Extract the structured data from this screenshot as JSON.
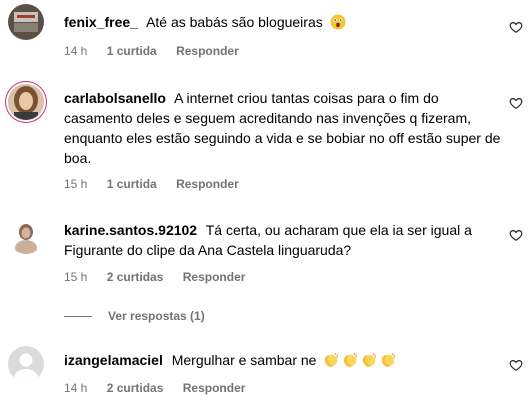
{
  "comments": [
    {
      "username": "fenix_free_",
      "text": "Até as babás são blogueiras",
      "emoji": "astonished-face",
      "time": "14 h",
      "likes": "1 curtida",
      "reply": "Responder"
    },
    {
      "username": "carlabolsanello",
      "text": "A internet criou tantas coisas para o fim do casamento deles e seguem acreditando nas invenções q fizeram, enquanto eles estão seguindo a vida e se bobiar no off estão super de boa.",
      "time": "15 h",
      "likes": "1 curtida",
      "reply": "Responder"
    },
    {
      "username": "karine.santos.92102",
      "text": "Tá certa, ou acharam que ela ia ser igual a Figurante do clipe da Ana Castela linguaruda?",
      "time": "15 h",
      "likes": "2 curtidas",
      "reply": "Responder",
      "view_replies": "Ver respostas (1)"
    },
    {
      "username": "izangelamaciel",
      "text": "Mergulhar e sambar ne",
      "emoji": "clapping-hands x4",
      "time": "14 h",
      "likes": "2 curtidas",
      "reply": "Responder"
    }
  ],
  "icons": {
    "like": "heart-outline-icon"
  },
  "colors": {
    "meta": "#737373",
    "text": "#000000"
  }
}
